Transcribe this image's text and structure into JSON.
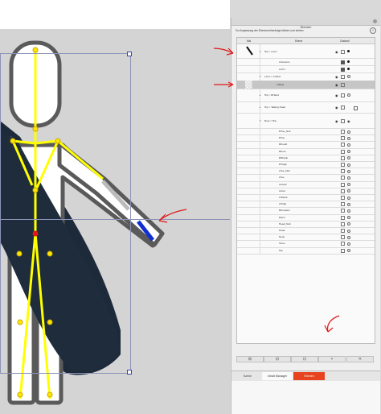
{
  "panel": {
    "title": "Ebenen",
    "hint": "Zur Anpassung der Ebenenreihenfolge klicken und ziehen.",
    "help_glyph": "?",
    "columns": {
      "mal": "Mal",
      "ebene": "Ebene",
      "zustand": "Zustand"
    },
    "rows": [
      {
        "label": "Hip > LArm",
        "expander": "▾",
        "eye": "◉",
        "lock": "open",
        "dot": "filled",
        "flag": false
      },
      {
        "label": "LForearm",
        "eye": "",
        "lock": "closed",
        "dot": "filled",
        "flag": false
      },
      {
        "label": "LArm",
        "eye": "",
        "lock": "closed",
        "dot": "filled",
        "flag": false
      },
      {
        "label": "LArm > LHand",
        "expander": "▾",
        "eye": "◉",
        "lock": "open",
        "dot": "hollow",
        "flag": false
      },
      {
        "label": "LHand",
        "eye": "◉",
        "lock": "open",
        "dot": "",
        "flag": false
      },
      {
        "label": "Hip > RHand",
        "expander": "▸",
        "eye": "◉",
        "lock": "open",
        "dot": "hollow",
        "flag": false
      },
      {
        "label": "Hip > Talking Head",
        "expander": "▸",
        "eye": "◉",
        "lock": "open",
        "dot": "",
        "flag": true
      },
      {
        "label": "Root > Hip",
        "expander": "▾",
        "eye": "◉",
        "lock": "open",
        "dot": "eye",
        "flag": false
      },
      {
        "label": "RToe_Nub",
        "lock": "open",
        "dot": "hollow"
      },
      {
        "label": "RToe",
        "lock": "open",
        "dot": "hollow"
      },
      {
        "label": "RFoot2",
        "lock": "open",
        "dot": "hollow"
      },
      {
        "label": "RFoot",
        "lock": "open",
        "dot": "hollow"
      },
      {
        "label": "RShank",
        "lock": "open",
        "dot": "hollow"
      },
      {
        "label": "RThigh",
        "lock": "open",
        "dot": "hollow"
      },
      {
        "label": "LToe_Nub",
        "lock": "open",
        "dot": "hollow"
      },
      {
        "label": "LToe",
        "lock": "open",
        "dot": "hollow"
      },
      {
        "label": "LFoot2",
        "lock": "open",
        "dot": "hollow"
      },
      {
        "label": "LFoot",
        "lock": "open",
        "dot": "hollow"
      },
      {
        "label": "LShank",
        "lock": "open",
        "dot": "hollow"
      },
      {
        "label": "LThigh",
        "lock": "open",
        "dot": "hollow"
      },
      {
        "label": "RForearm",
        "lock": "open",
        "dot": "hollow"
      },
      {
        "label": "RArm",
        "lock": "open",
        "dot": "hollow"
      },
      {
        "label": "Head_Nub",
        "lock": "open",
        "dot": "hollow"
      },
      {
        "label": "Head",
        "lock": "open",
        "dot": "hollow"
      },
      {
        "label": "Neck",
        "lock": "open",
        "dot": "hollow"
      },
      {
        "label": "Torso",
        "lock": "open",
        "dot": "hollow"
      },
      {
        "label": "Hip",
        "lock": "open",
        "dot": "hollow"
      }
    ],
    "bottom_buttons": [
      "⊞",
      "⊟",
      "⊡",
      "+",
      "✕"
    ],
    "tabs": [
      {
        "label": "Szene",
        "state": "inactive"
      },
      {
        "label": "Inhalt Manager",
        "state": "mid"
      },
      {
        "label": "Ebenen",
        "state": "active"
      }
    ]
  },
  "colors": {
    "accent": "#e8431f",
    "bone": "#ffff00",
    "joint": "#ffe600",
    "annotation": "#e01818"
  }
}
